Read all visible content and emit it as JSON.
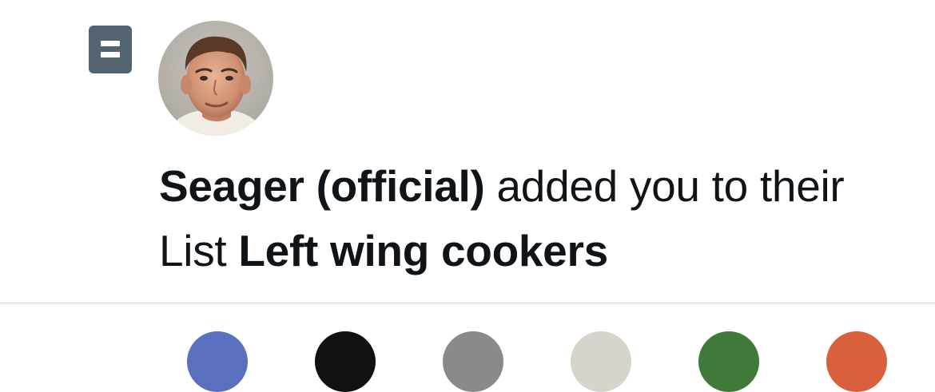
{
  "notification": {
    "icon": "list-icon",
    "avatar": "user-avatar-photo",
    "actor_name": "Seager (official)",
    "action_text": " added you to their List ",
    "list_name": "Left wing cookers"
  },
  "colors": {
    "text_primary": "#0f1419",
    "list_icon_bg": "#536471",
    "divider": "#d7dbdf"
  },
  "next_notification": {
    "avatar_colors": [
      "#5b6fbf",
      "#111111",
      "#8a8a8a",
      "#d8d4cc",
      "#3f7a3a",
      "#d8603c"
    ]
  }
}
